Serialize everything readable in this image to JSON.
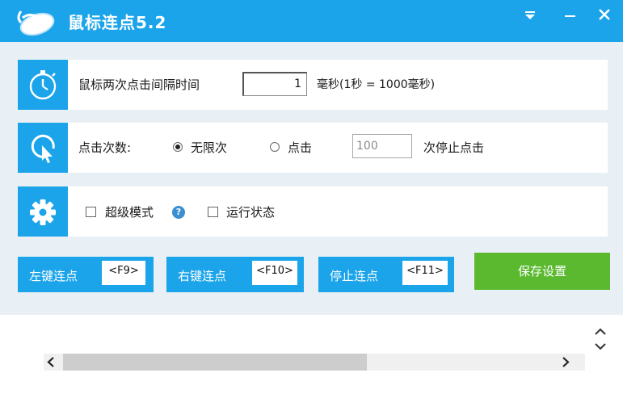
{
  "window": {
    "title": "鼠标连点5.2",
    "icons": [
      "mouse-logo-icon",
      "dropdown-arrow-icon",
      "minimize-icon",
      "close-icon"
    ],
    "accent_color": "#1ba4ea"
  },
  "interval_row": {
    "icon": "stopwatch-icon",
    "label": "鼠标两次点击间隔时间",
    "value": "1",
    "unit": "毫秒(1秒 = 1000毫秒)"
  },
  "count_row": {
    "icon": "cursor-click-icon",
    "label": "点击次数:",
    "option_unlimited": "无限次",
    "option_count": "点击",
    "count_value": "100",
    "suffix": "次停止点击",
    "selected": "无限次"
  },
  "settings_row": {
    "icon": "gear-icon",
    "super_mode_label": "超级模式",
    "run_state_label": "运行状态",
    "super_mode_checked": false,
    "run_state_checked": false
  },
  "buttons": {
    "left_click": {
      "label": "左键连点",
      "hotkey": "<F9>"
    },
    "right_click": {
      "label": "右键连点",
      "hotkey": "<F10>"
    },
    "stop_click": {
      "label": "停止连点",
      "hotkey": "<F11>"
    },
    "save": {
      "label": "保存设置",
      "color": "#5ab92f"
    }
  }
}
